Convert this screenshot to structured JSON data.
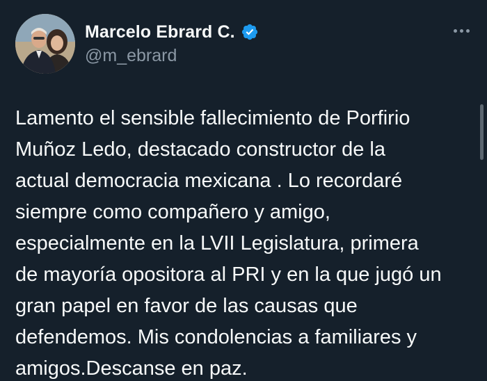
{
  "author": {
    "display_name": "Marcelo Ebrard C.",
    "handle": "@m_ebrard",
    "verified": true,
    "avatar": "profile-photo"
  },
  "tweet": {
    "text": "Lamento el sensible fallecimiento de Porfirio\nMuñoz Ledo, destacado constructor de la\nactual democracia mexicana . Lo recordaré\nsiempre como compañero y amigo,\nespecialmente en la LVII Legislatura, primera\nde mayoría opositora al PRI y en la que jugó un\ngran papel en favor de las causas que\ndefendemos. Mis condolencias a familiares y\namigos.Descanse en paz."
  },
  "icons": {
    "verified": "verified-badge-icon",
    "more": "more-options-icon"
  },
  "colors": {
    "background": "#15202b",
    "text_primary": "#f7f9f9",
    "text_secondary": "#8b98a5",
    "verified_blue": "#1d9bf0"
  }
}
